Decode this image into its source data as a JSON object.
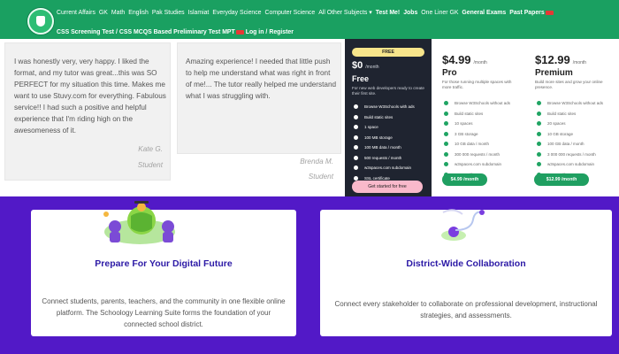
{
  "nav": {
    "row1": [
      {
        "label": "Current Affairs",
        "bold": false
      },
      {
        "label": "GK",
        "bold": false
      },
      {
        "label": "Math",
        "bold": false
      },
      {
        "label": "English",
        "bold": false
      },
      {
        "label": "Pak Studies",
        "bold": false
      },
      {
        "label": "Islamiat",
        "bold": false
      },
      {
        "label": "Everyday Science",
        "bold": false
      },
      {
        "label": "Computer Science",
        "bold": false
      },
      {
        "label": "All Other Subjects",
        "bold": false
      },
      {
        "label": "Test Me!",
        "bold": true
      },
      {
        "label": "Jobs",
        "bold": true
      },
      {
        "label": "One Liner GK",
        "bold": false
      },
      {
        "label": "General Exams",
        "bold": true
      },
      {
        "label": "Past Papers",
        "bold": true
      }
    ],
    "row2": [
      "CSS Screening Test",
      "CSS MCQS Based Preliminary Test MPT",
      "Log in",
      "Register"
    ],
    "dropdown_caret": "▾",
    "separator": "/"
  },
  "testimonials": [
    {
      "quote": "I was honestly very, very happy. I liked the format, and my tutor was great...this was SO PERFECT for my situation this time. Makes me want to use Stuvy.com for everything. Fabulous service!! I had such a positive and helpful experience that I'm riding high on the awesomeness of it.",
      "name": "Kate G.",
      "role": "Student"
    },
    {
      "quote": "Amazing experience! I needed that little push to help me understand what was right in front of me!... The tutor really helped me understand what I was struggling with.",
      "name": "Brenda M.",
      "role": "Student"
    }
  ],
  "pricing": {
    "free": {
      "pill": "FREE",
      "price": "$0",
      "period": "/month",
      "name": "Free",
      "desc": "For new web developers ready to create their first site.",
      "features": [
        "Browse W3Schools with ads",
        "Build static sites",
        "1 space",
        "100 MB storage",
        "100 MB data / month",
        "500 requests / month",
        "w3spaces.com subdomain",
        "SSL certificate"
      ],
      "button": "Get started for free"
    },
    "pro": {
      "price": "$4.99",
      "period": "/month",
      "name": "Pro",
      "desc": "For those running multiple spaces with more traffic.",
      "features": [
        "Browse W3Schools without ads",
        "Build static sites",
        "10 spaces",
        "3 GB storage",
        "10 GB data / month",
        "300 000 requests / month",
        "w3spaces.com subdomain",
        "SSL certificate"
      ],
      "button": "$4.99 /month"
    },
    "premium": {
      "price": "$12.99",
      "period": "/month",
      "name": "Premium",
      "desc": "Build more sites and grow your online presence.",
      "features": [
        "Browse W3Schools without ads",
        "Build static sites",
        "20 spaces",
        "10 GB storage",
        "100 GB data / month",
        "3 000 000 requests / month",
        "w3spaces.com subdomain",
        "SSL certificate"
      ],
      "button": "$12.99 /month"
    }
  },
  "features": [
    {
      "title": "Prepare For Your Digital Future",
      "desc": "Connect students, parents, teachers, and the community in one flexible online platform. The Schoology Learning Suite forms the foundation of your connected school district."
    },
    {
      "title": "District-Wide Collaboration",
      "desc": "Connect every stakeholder to collaborate on professional development, instructional strategies, and assessments."
    }
  ],
  "colors": {
    "nav_green": "#1aa061",
    "band_purple": "#5219c7",
    "feature_title": "#2c1aa6",
    "plan_dark": "#1f2430",
    "plan_button_green": "#1f9f61",
    "free_button_pink": "#f9b9cb",
    "free_pill_yellow": "#f7e58b"
  },
  "icons": {
    "logo": "site-logo-badge",
    "check": "check-circle-icon",
    "illustration1": "students-globe-illustration",
    "illustration2": "collaboration-pin-illustration"
  }
}
